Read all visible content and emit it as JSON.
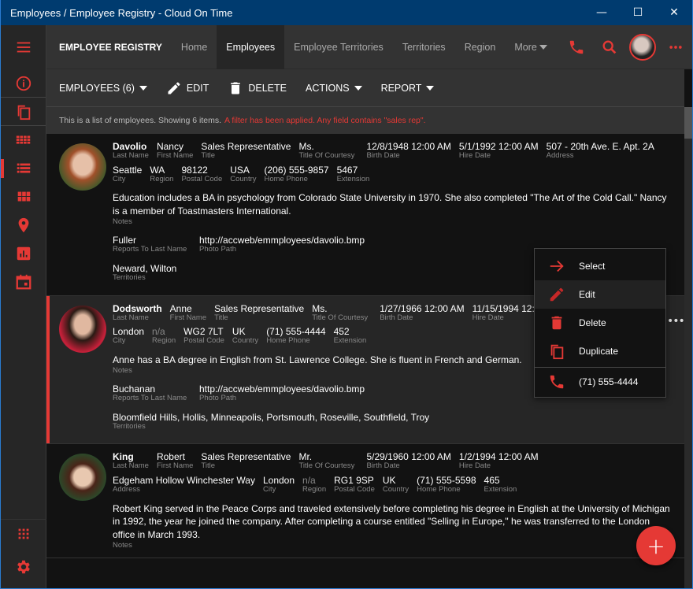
{
  "window": {
    "title": "Employees / Employee Registry - Cloud On Time",
    "minimize": "—",
    "maximize": "☐",
    "close": "✕"
  },
  "nav": {
    "brand": "EMPLOYEE REGISTRY",
    "tabs": [
      {
        "label": "Home",
        "active": false
      },
      {
        "label": "Employees",
        "active": true
      },
      {
        "label": "Employee Territories",
        "active": false
      },
      {
        "label": "Territories",
        "active": false
      },
      {
        "label": "Region",
        "active": false
      },
      {
        "label": "More",
        "active": false
      }
    ]
  },
  "toolbar": {
    "view": "EMPLOYEES (6)",
    "edit": "EDIT",
    "delete": "DELETE",
    "actions": "ACTIONS",
    "report": "REPORT"
  },
  "info": {
    "text": "This is a list of employees. Showing 6 items.",
    "filter": "A filter has been applied. Any field contains \"sales rep\"."
  },
  "accent_color": "#e53935",
  "employees": [
    {
      "last_name": "Davolio",
      "first_name": "Nancy",
      "title": "Sales Representative",
      "courtesy": "Ms.",
      "birth_date": "12/8/1948 12:00 AM",
      "hire_date": "5/1/1992 12:00 AM",
      "address": "507 - 20th Ave. E. Apt. 2A",
      "city": "Seattle",
      "region": "WA",
      "postal_code": "98122",
      "country": "USA",
      "home_phone": "(206) 555-9857",
      "extension": "5467",
      "notes": "Education includes a BA in psychology from Colorado State University in 1970. She also completed \"The Art of the Cold Call.\" Nancy is a member of Toastmasters International.",
      "reports_to": "Fuller",
      "photo_path": "http://accweb/emmployees/davolio.bmp",
      "territories": "Neward, Wilton"
    },
    {
      "last_name": "Dodsworth",
      "first_name": "Anne",
      "title": "Sales Representative",
      "courtesy": "Ms.",
      "birth_date": "1/27/1966 12:00 AM",
      "hire_date": "11/15/1994 12:00 AM",
      "city": "London",
      "region": "n/a",
      "postal_code": "WG2 7LT",
      "country": "UK",
      "home_phone": "(71) 555-4444",
      "extension": "452",
      "notes": "Anne has a BA degree in English from St. Lawrence College. She is fluent in French and German.",
      "reports_to": "Buchanan",
      "photo_path": "http://accweb/emmployees/davolio.bmp",
      "territories": "Bloomfield Hills, Hollis, Minneapolis, Portsmouth, Roseville, Southfield, Troy"
    },
    {
      "last_name": "King",
      "first_name": "Robert",
      "title": "Sales Representative",
      "courtesy": "Mr.",
      "birth_date": "5/29/1960 12:00 AM",
      "hire_date": "1/2/1994 12:00 AM",
      "address": "Edgeham Hollow Winchester Way",
      "city": "London",
      "region": "n/a",
      "postal_code": "RG1 9SP",
      "country": "UK",
      "home_phone": "(71) 555-5598",
      "extension": "465",
      "notes": "Robert King served in the Peace Corps and traveled extensively before completing his degree in English at the University of Michigan in 1992, the year he joined the company. After completing a course entitled \"Selling in Europe,\" he was transferred to the London office in March 1993."
    }
  ],
  "labels": {
    "last_name": "Last Name",
    "first_name": "First Name",
    "title": "Title",
    "courtesy": "Title Of Courtesy",
    "birth_date": "Birth Date",
    "hire_date": "Hire Date",
    "address": "Address",
    "city": "City",
    "region": "Region",
    "postal_code": "Postal Code",
    "country": "Country",
    "home_phone": "Home Phone",
    "extension": "Extension",
    "notes": "Notes",
    "reports_to": "Reports To Last Name",
    "photo_path": "Photo Path",
    "territories": "Territories"
  },
  "context_menu": {
    "select": "Select",
    "edit": "Edit",
    "delete": "Delete",
    "duplicate": "Duplicate",
    "phone": "(71) 555-4444"
  },
  "more_dots": "•••",
  "fab": "+"
}
